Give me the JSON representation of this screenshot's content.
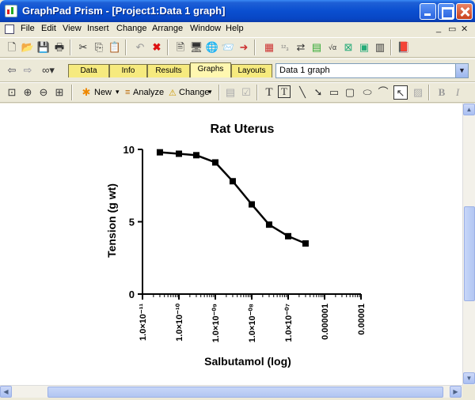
{
  "window": {
    "title": "GraphPad Prism - [Project1:Data 1 graph]"
  },
  "menu": {
    "items": [
      "File",
      "Edit",
      "View",
      "Insert",
      "Change",
      "Arrange",
      "Window",
      "Help"
    ]
  },
  "doc_tabs": [
    "Data",
    "Info",
    "Results",
    "Graphs",
    "Layouts"
  ],
  "active_tab": "Graphs",
  "sheet_selector": {
    "value": "Data 1 graph"
  },
  "graph_toolbar": {
    "new_label": "New",
    "analyze_label": "Analyze",
    "change_label": "Change"
  },
  "chart_data": {
    "type": "line",
    "title": "Rat Uterus",
    "xlabel": "Salbutamol (log)",
    "ylabel": "Tension (g wt)",
    "x_scale": "log",
    "xlim": [
      1e-11,
      1e-05
    ],
    "ylim": [
      0,
      10
    ],
    "x_tick_labels": [
      "1.0×10⁻¹¹",
      "1.0×10⁻¹⁰",
      "1.0×10⁻⁰⁹",
      "1.0×10⁻⁰⁸",
      "1.0×10⁻⁰⁷",
      "0.000001",
      "0.00001"
    ],
    "y_ticks": [
      0,
      5,
      10
    ],
    "series": [
      {
        "x": [
          3e-11,
          1e-10,
          3e-10,
          1e-09,
          3e-09,
          1e-08,
          3e-08,
          1e-07,
          3e-07
        ],
        "values": [
          9.8,
          9.7,
          9.6,
          9.1,
          7.8,
          6.2,
          4.8,
          4.0,
          3.5
        ]
      }
    ],
    "marker": "square",
    "grid": false
  }
}
